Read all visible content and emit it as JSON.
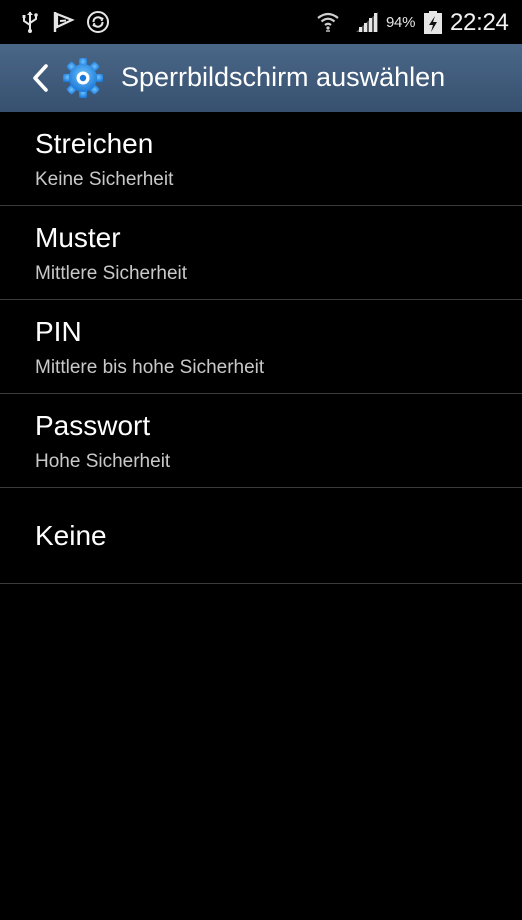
{
  "status_bar": {
    "icons": [
      "usb-icon",
      "screen-mirroring-icon",
      "sync-icon",
      "wifi-icon",
      "signal-icon",
      "battery-charging-icon"
    ],
    "battery_percent": "94%",
    "time": "22:24"
  },
  "action_bar": {
    "back_icon": "chevron-left-icon",
    "app_icon": "settings-gear-icon",
    "title": "Sperrbildschirm auswählen",
    "background_color": "#3f5a7a"
  },
  "options": [
    {
      "title": "Streichen",
      "subtitle": "Keine Sicherheit"
    },
    {
      "title": "Muster",
      "subtitle": "Mittlere Sicherheit"
    },
    {
      "title": "PIN",
      "subtitle": "Mittlere bis hohe Sicherheit"
    },
    {
      "title": "Passwort",
      "subtitle": "Hohe Sicherheit"
    },
    {
      "title": "Keine"
    }
  ]
}
